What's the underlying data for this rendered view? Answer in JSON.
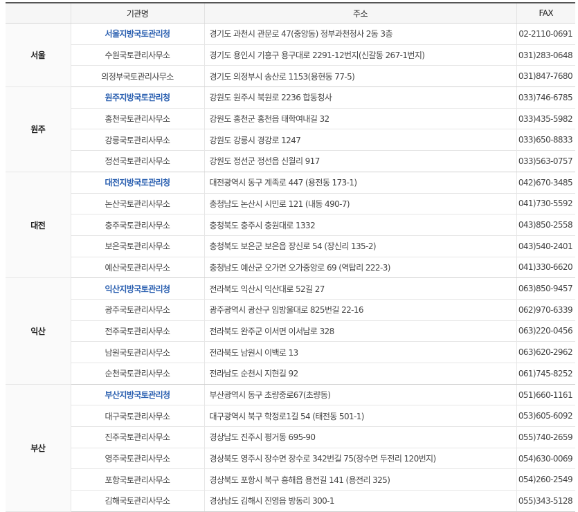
{
  "headers": {
    "region": "",
    "org": "기관명",
    "address": "주소",
    "fax": "FAX"
  },
  "groups": [
    {
      "region": "서울",
      "rows": [
        {
          "org": "서울지방국토관리청",
          "address": "경기도 과천시 관문로 47(중앙동) 정부과천청사 2동 3층",
          "fax": "02-2110-0691",
          "main": true
        },
        {
          "org": "수원국토관리사무소",
          "address": "경기도 용인시 기흥구 용구대로 2291-12번지(신갈동 267-1번지)",
          "fax": "031)283-0648"
        },
        {
          "org": "의정부국토관리사무소",
          "address": "경기도 의정부시 송산로 1153(용현동 77-5)",
          "fax": "031)847-7680"
        }
      ]
    },
    {
      "region": "원주",
      "rows": [
        {
          "org": "원주지방국토관리청",
          "address": "강원도 원주시 북원로 2236 합동청사",
          "fax": "033)746-6785",
          "main": true
        },
        {
          "org": "홍천국토관리사무소",
          "address": "강원도 홍천군 홍천읍 태학여내길 32",
          "fax": "033)435-5982"
        },
        {
          "org": "강릉국토관리사무소",
          "address": "강원도 강릉시 경강로 1247",
          "fax": "033)650-8833"
        },
        {
          "org": "정선국토관리사무소",
          "address": "강원도 정선군 정선읍 신월리 917",
          "fax": "033)563-0757"
        }
      ]
    },
    {
      "region": "대전",
      "rows": [
        {
          "org": "대전지방국토관리청",
          "address": "대전광역시 동구 계족로 447 (용전동 173-1)",
          "fax": "042)670-3485",
          "main": true
        },
        {
          "org": "논산국토관리사무소",
          "address": "충청남도 논산시 시민로 121 (내동 490-7)",
          "fax": "041)730-5592"
        },
        {
          "org": "충주국토관리사무소",
          "address": "충청북도 충주시 충원대로 1332",
          "fax": "043)850-2558"
        },
        {
          "org": "보은국토관리사무소",
          "address": "충청북도 보은군 보은읍 장신로 54 (장신리 135-2)",
          "fax": "043)540-2401"
        },
        {
          "org": "예산국토관리사무소",
          "address": "충청남도 예산군 오가면 오가중앙로 69 (역탑리 222-3)",
          "fax": "041)330-6620"
        }
      ]
    },
    {
      "region": "익산",
      "rows": [
        {
          "org": "익산지방국토관리청",
          "address": "전라북도 익산시 익산대로 52길 27",
          "fax": "063)850-9457",
          "main": true
        },
        {
          "org": "광주국토관리사무소",
          "address": "광주광역시 광산구 임방울대로 825번길 22-16",
          "fax": "062)970-6339"
        },
        {
          "org": "전주국토관리사무소",
          "address": "전라북도 완주군 이서면 이서남로 328",
          "fax": "063)220-0456"
        },
        {
          "org": "남원국토관리사무소",
          "address": "전라북도 남원시 이백로 13",
          "fax": "063)620-2962"
        },
        {
          "org": "순천국토관리사무소",
          "address": "전라남도 순천시 지현길 92",
          "fax": "061)745-8252"
        }
      ]
    },
    {
      "region": "부산",
      "rows": [
        {
          "org": "부산지방국토관리청",
          "address": "부산광역시 동구 초량중로67(초량동)",
          "fax": "051)660-1161",
          "main": true
        },
        {
          "org": "대구국토관리사무소",
          "address": "대구광역시 북구 학정로1길 54 (태전동 501-1)",
          "fax": "053)605-6092"
        },
        {
          "org": "진주국토관리사무소",
          "address": "경상남도 진주시 평거동 695-90",
          "fax": "055)740-2659"
        },
        {
          "org": "영주국토관리사무소",
          "address": "경상북도 영주시 장수면 장수로 342번길 75(장수면 두전리 120번지)",
          "fax": "054)630-0069"
        },
        {
          "org": "포항국토관리사무소",
          "address": "경상북도 포항시 북구 흥해읍 용전길 141 (용전리 325)",
          "fax": "054)260-2549"
        },
        {
          "org": "김해국토관리사무소",
          "address": "경상남도 김해시 진영읍 방동리 300-1",
          "fax": "055)343-5128"
        }
      ]
    }
  ]
}
